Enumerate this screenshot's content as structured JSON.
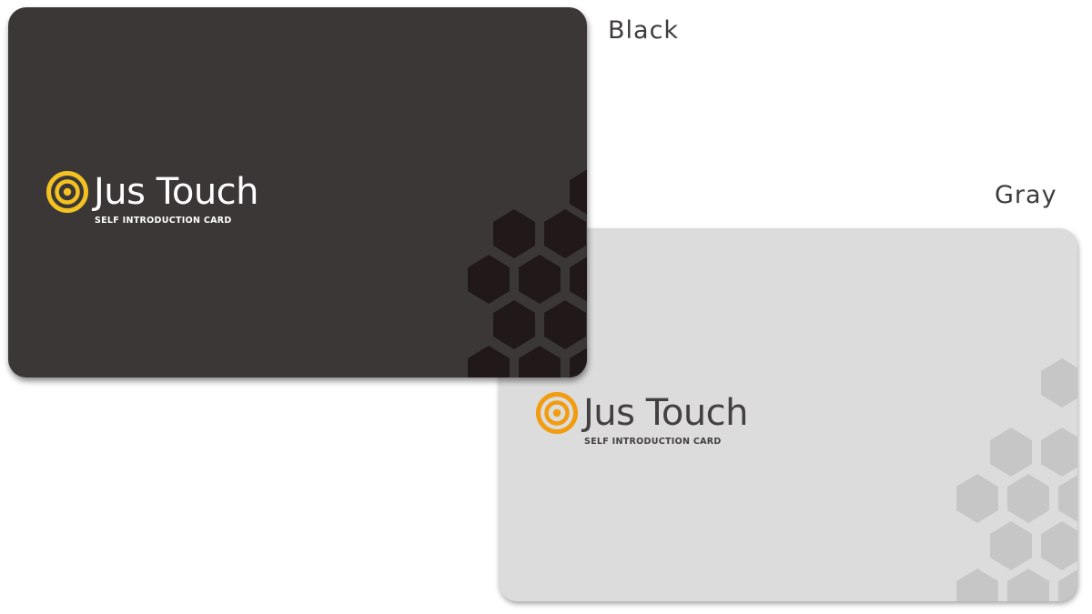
{
  "variants": [
    {
      "label": "Black",
      "card": {
        "brand_name": "Jus Touch",
        "tagline": "SELF INTRODUCTION CARD"
      },
      "colors": {
        "card": "#3c3737",
        "hexagon": "#211919",
        "logo_icon": "#f3c221",
        "text": "#ffffff"
      }
    },
    {
      "label": "Gray",
      "card": {
        "brand_name": "Jus Touch",
        "tagline": "SELF INTRODUCTION CARD"
      },
      "colors": {
        "card": "#dcdcdc",
        "hexagon": "#c6c6c6",
        "logo_icon": "#f29c0f",
        "text": "#444040"
      }
    }
  ]
}
